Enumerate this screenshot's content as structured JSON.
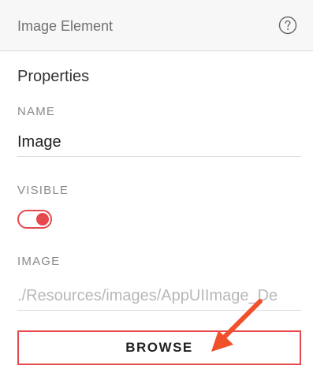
{
  "header": {
    "title": "Image Element",
    "help_icon": "help-circle-icon"
  },
  "properties": {
    "section_title": "Properties",
    "name": {
      "label": "NAME",
      "value": "Image"
    },
    "visible": {
      "label": "VISIBLE",
      "on": true
    },
    "image": {
      "label": "IMAGE",
      "value": "./Resources/images/AppUIImage_De"
    },
    "browse_label": "BROWSE"
  },
  "colors": {
    "accent": "#e5484d",
    "arrow": "#f0502a"
  },
  "annotation": {
    "icon": "red-arrow-icon"
  }
}
